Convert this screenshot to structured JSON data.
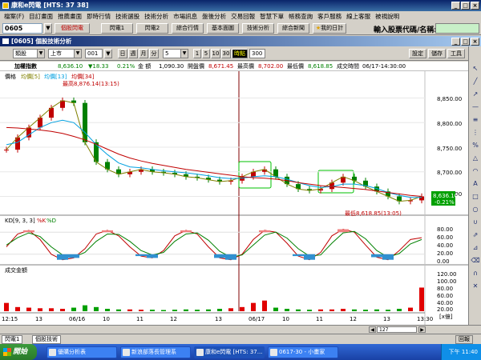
{
  "app": {
    "title": "康和e閃電 [HTS: 37 38]"
  },
  "menu": [
    "檔案(F)",
    "目訂畫面",
    "推薦畫面",
    "即時行情",
    "技術選股",
    "技術分析",
    "市場訊息",
    "盤後分析",
    "交易回報",
    "智慧下單",
    "帳務查詢",
    "客戶服務",
    "線上客服",
    "被視說明"
  ],
  "toolbar": {
    "stock_combo": "0605",
    "buttons": [
      "個股閃電",
      "閃電1",
      "閃電2",
      "綜合行情",
      "基本面圖",
      "技術分析",
      "綜合新聞"
    ],
    "my_plan": "我的日計",
    "stock_input_label": "輸入股票代碼/名稱:",
    "stock_input_value": ""
  },
  "doc_title": "[0605] 個股技術分析",
  "chart_toolbar": {
    "group_select": "類股",
    "market_select": "上市",
    "code_select": "001",
    "period_buttons": [
      "日",
      "週",
      "月",
      "分"
    ],
    "interval_select": "5",
    "minute_buttons": [
      "1",
      "5",
      "10",
      "30"
    ],
    "tick_label": "時點",
    "count_value": "300",
    "right_buttons": [
      "設定",
      "儲存",
      "工具"
    ]
  },
  "quote": {
    "name": "加權指數",
    "price": "8,636.10",
    "change": "▼18.33",
    "change_pct": "0.21%",
    "amount_label": "金 額",
    "amount": "1,090.30",
    "open_label": "開盤價",
    "open": "8,671.45",
    "high_label": "最高價",
    "high": "8,702.00",
    "low_label": "最低價",
    "low": "8,618.85",
    "time_label": "成交時間",
    "time": "06/17-14:30:00"
  },
  "price_panel": {
    "legend": [
      "價格",
      "均價[5]",
      "均價[13]",
      "均價[34]"
    ],
    "legend_colors": [
      "#000000",
      "#808000",
      "#00a0e0",
      "#c00000"
    ],
    "high_note": "最高8,876.14(13:15)",
    "low_note": "最低8,618.85(13:05)",
    "y_ticks": [
      "8,850.00",
      "8,800.00",
      "8,750.00",
      "8,700.00",
      "8,650.00"
    ],
    "last_price": "8,636.10",
    "last_change": "-0.21%"
  },
  "kd_panel": {
    "legend": "KD[9, 3, 3]",
    "legend_k": "%K",
    "legend_d": "%D",
    "y_ticks": [
      "80.00",
      "60.00",
      "40.00",
      "20.00",
      "0.00"
    ]
  },
  "volume_panel": {
    "legend": "成交金額",
    "y_ticks": [
      "120.00",
      "100.00",
      "80.00",
      "60.00",
      "40.00",
      "20.00"
    ],
    "unit": "[x億]"
  },
  "x_axis": [
    "12:15",
    "13",
    "06/16",
    "10",
    "11",
    "12",
    "13",
    "06/17",
    "10",
    "11",
    "12",
    "13",
    "13:30"
  ],
  "scroll": {
    "page_label": "127"
  },
  "bottom_tabs": [
    "閃電1",
    "個股技術"
  ],
  "bottom_right_button": "回報",
  "taskbar": {
    "start": "開始",
    "tasks": [
      "優購分析表",
      "新浪部落長管理系",
      "康和e閃電 [HTS: 37...",
      "0617-30 - 小畫家"
    ],
    "clock": "下午 11:40"
  },
  "chart_data": [
    {
      "type": "candlestick",
      "title": "",
      "series": [
        {
          "name": "均價[5]",
          "values": [
            8745,
            8770,
            8790,
            8810,
            8830,
            8845,
            8840,
            8760,
            8720,
            8705,
            8695,
            8700,
            8705,
            8700,
            8698,
            8695,
            8690,
            8688,
            8684,
            8680,
            8682,
            8690,
            8700,
            8705,
            8690,
            8675,
            8665,
            8662,
            8665,
            8678,
            8690,
            8682,
            8670,
            8660,
            8650,
            8640,
            8642,
            8650
          ]
        },
        {
          "name": "均價[13]",
          "values": [
            8755,
            8760,
            8775,
            8790,
            8800,
            8805,
            8800,
            8780,
            8755,
            8735,
            8718,
            8710,
            8708,
            8705,
            8702,
            8700,
            8698,
            8695,
            8692,
            8688,
            8686,
            8687,
            8690,
            8692,
            8690,
            8685,
            8678,
            8672,
            8668,
            8670,
            8675,
            8675,
            8672,
            8666,
            8658,
            8652,
            8648,
            8648
          ]
        },
        {
          "name": "均價[34]",
          "values": [
            8790,
            8789,
            8787,
            8785,
            8782,
            8778,
            8772,
            8765,
            8756,
            8746,
            8736,
            8728,
            8722,
            8717,
            8713,
            8709,
            8705,
            8702,
            8699,
            8696,
            8693,
            8690,
            8688,
            8687,
            8685,
            8682,
            8678,
            8675,
            8672,
            8670,
            8668,
            8666,
            8664,
            8661,
            8658,
            8655,
            8652,
            8650
          ]
        }
      ],
      "ylim": [
        8615,
        8885
      ],
      "high": 8876.14,
      "low": 8618.85
    },
    {
      "type": "line",
      "title": "KD[9, 3, 3]",
      "series": [
        {
          "name": "%K",
          "values": [
            40,
            75,
            85,
            60,
            20,
            5,
            10,
            35,
            75,
            85,
            70,
            40,
            15,
            10,
            30,
            70,
            85,
            75,
            40,
            10,
            5,
            20,
            60,
            85,
            80,
            50,
            15,
            5,
            25,
            70,
            88,
            80,
            45,
            12,
            5,
            30,
            60,
            65
          ]
        },
        {
          "name": "%D",
          "values": [
            45,
            65,
            78,
            68,
            40,
            18,
            12,
            25,
            55,
            75,
            74,
            55,
            30,
            18,
            25,
            55,
            75,
            78,
            58,
            28,
            12,
            18,
            45,
            72,
            80,
            64,
            35,
            15,
            18,
            50,
            78,
            82,
            62,
            30,
            12,
            22,
            48,
            60
          ]
        }
      ],
      "ylim": [
        0,
        100
      ]
    },
    {
      "type": "bar",
      "title": "成交金額",
      "ylabel": "[x億]",
      "values": [
        28,
        14,
        12,
        10,
        10,
        8,
        12,
        20,
        14,
        8,
        6,
        6,
        5,
        5,
        4,
        5,
        6,
        5,
        6,
        8,
        10,
        14,
        28,
        36,
        12,
        8,
        6,
        5,
        6,
        6,
        8,
        6,
        5,
        6,
        5,
        8,
        12,
        80
      ],
      "ylim": [
        0,
        130
      ]
    }
  ]
}
